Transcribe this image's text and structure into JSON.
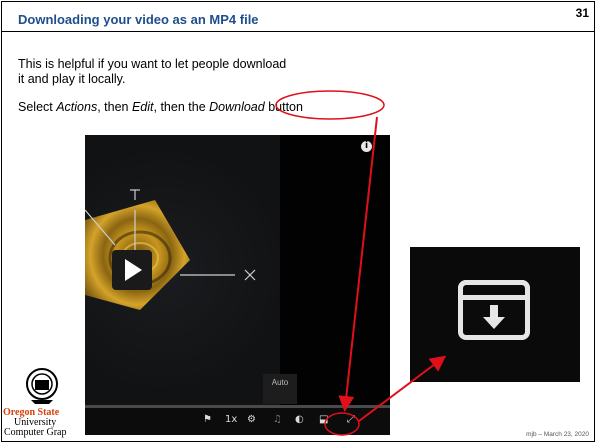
{
  "slide": {
    "title": "Downloading your video as an MP4 file",
    "number": "31",
    "para1_line1": "This is helpful if you want to let people download",
    "para1_line2": "it and play it locally.",
    "para2_prefix": "Select ",
    "para2_actions": "Actions",
    "para2_mid1": ", then ",
    "para2_edit": "Edit",
    "para2_mid2": ", then the ",
    "para2_download": "Download",
    "para2_suffix": " button",
    "footer": "mjb – March 23, 2020"
  },
  "logo": {
    "line1": "Oregon State",
    "line2": "University",
    "line3": "Computer Grap"
  },
  "player": {
    "info_icon": "info-icon",
    "speed": "1x",
    "quality_tooltip": "Auto",
    "controls": [
      "flag-icon",
      "speed-label",
      "settings-icon",
      "music-icon",
      "captions-icon",
      "download-icon",
      "fullscreen-icon"
    ]
  },
  "colors": {
    "title": "#1f4e8c",
    "annotation": "#e0101a",
    "osu_orange": "#d73f09"
  }
}
